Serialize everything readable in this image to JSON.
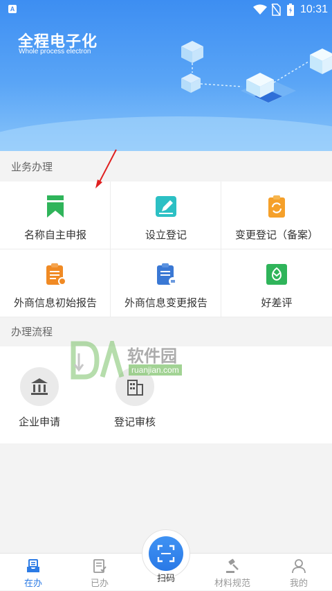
{
  "status_bar": {
    "time": "10:31"
  },
  "banner": {
    "title": "全程电子化",
    "subtitle": "Whole process electron"
  },
  "business": {
    "section_title": "业务办理",
    "items": [
      {
        "label": "名称自主申报",
        "icon": "bookmark-icon",
        "color": "#2fb45a"
      },
      {
        "label": "设立登记",
        "icon": "edit-notebook-icon",
        "color": "#2cc0c4"
      },
      {
        "label": "变更登记（备案）",
        "icon": "clipboard-refresh-icon",
        "color": "#f5a02a"
      },
      {
        "label": "外商信息初始报告",
        "icon": "clipboard-report-icon",
        "color": "#f08a24"
      },
      {
        "label": "外商信息变更报告",
        "icon": "clipboard-exchange-icon",
        "color": "#3a78d4"
      },
      {
        "label": "好差评",
        "icon": "flower-badge-icon",
        "color": "#2fb45a"
      }
    ]
  },
  "process": {
    "section_title": "办理流程",
    "steps": [
      {
        "label": "企业申请",
        "icon": "bank-icon"
      },
      {
        "label": "登记审核",
        "icon": "building-icon"
      }
    ]
  },
  "watermark": {
    "brand": "软件园",
    "domain": "ruanjian.com"
  },
  "tabbar": {
    "tabs": [
      {
        "label": "在办",
        "icon": "inbox-icon",
        "active": true
      },
      {
        "label": "已办",
        "icon": "checklist-icon",
        "active": false
      },
      {
        "label": "扫码",
        "icon": "scan-icon",
        "active": false
      },
      {
        "label": "材料规范",
        "icon": "gavel-icon",
        "active": false
      },
      {
        "label": "我的",
        "icon": "user-icon",
        "active": false
      }
    ]
  },
  "colors": {
    "primary": "#2c7be5",
    "banner_start": "#3d8ef2",
    "banner_end": "#88c4fa"
  }
}
